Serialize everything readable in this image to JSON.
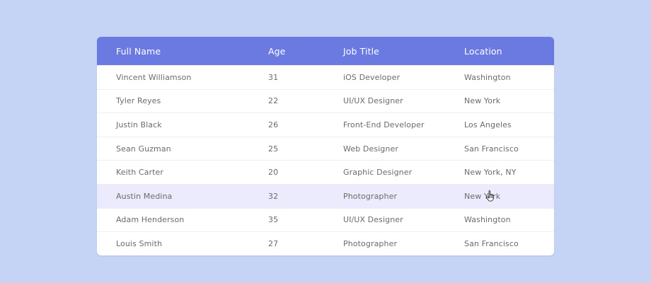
{
  "colors": {
    "page_background": "#c5d3f4",
    "header_background": "#6b7ae0",
    "header_text": "#ffffff",
    "row_text": "#6b6b6b",
    "row_hover_background": "#ecebfd",
    "row_border": "#eeeff6"
  },
  "table": {
    "columns": [
      "Full Name",
      "Age",
      "Job Title",
      "Location"
    ],
    "rows": [
      [
        "Vincent Williamson",
        "31",
        "iOS Developer",
        "Washington"
      ],
      [
        "Tyler Reyes",
        "22",
        "UI/UX Designer",
        "New York"
      ],
      [
        "Justin Black",
        "26",
        "Front-End Developer",
        "Los Angeles"
      ],
      [
        "Sean Guzman",
        "25",
        "Web Designer",
        "San Francisco"
      ],
      [
        "Keith Carter",
        "20",
        "Graphic Designer",
        "New York, NY"
      ],
      [
        "Austin Medina",
        "32",
        "Photographer",
        "New York"
      ],
      [
        "Adam Henderson",
        "35",
        "UI/UX Designer",
        "Washington"
      ],
      [
        "Louis Smith",
        "27",
        "Photographer",
        "San Francisco"
      ]
    ],
    "hovered_row": 5
  },
  "cursor": {
    "icon": "hand-pointer-icon"
  }
}
